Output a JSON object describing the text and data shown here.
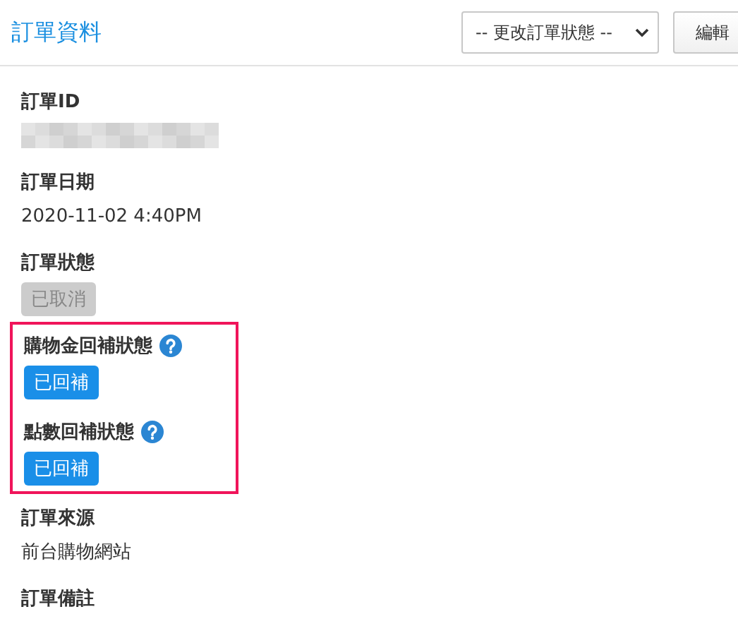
{
  "header": {
    "title": "訂單資料",
    "status_select": {
      "value": "-- 更改訂單狀態 --"
    },
    "edit_button": "編輯"
  },
  "sections": [
    {
      "kind": "redacted",
      "label": "訂單ID"
    },
    {
      "kind": "text",
      "label": "訂單日期",
      "value": "2020-11-02 4:40PM"
    },
    {
      "kind": "badge",
      "label": "訂單狀態",
      "value": "已取消",
      "color": "#cccccc"
    },
    {
      "kind": "group",
      "fields": [
        {
          "kind": "badge",
          "label": "購物金回補狀態",
          "help": true,
          "value": "已回補",
          "color": "#1a8fe8"
        },
        {
          "kind": "badge",
          "label": "點數回補狀態",
          "help": true,
          "value": "已回補",
          "color": "#1a8fe8"
        }
      ]
    },
    {
      "kind": "text",
      "label": "訂單來源",
      "value": "前台購物網站"
    },
    {
      "kind": "label_only",
      "label": "訂單備註"
    }
  ]
}
